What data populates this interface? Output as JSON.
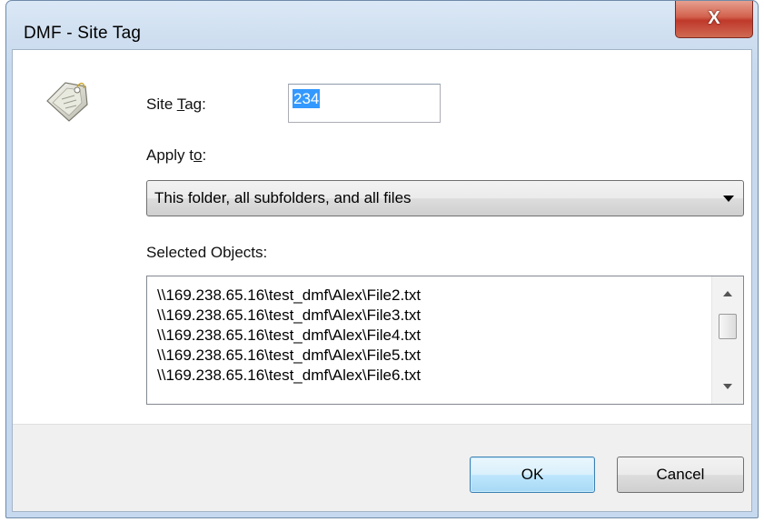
{
  "window": {
    "title": "DMF - Site Tag",
    "close_label": "X"
  },
  "form": {
    "site_tag_label_pre": "Site ",
    "site_tag_label_key": "T",
    "site_tag_label_post": "ag:",
    "site_tag_value": "234",
    "apply_to_label_pre": "Apply t",
    "apply_to_label_key": "o",
    "apply_to_label_post": ":",
    "apply_to_selected": "This folder, all subfolders, and all files",
    "selected_objects_label": "Selected Objects:",
    "selected_objects": [
      "\\\\169.238.65.16\\test_dmf\\Alex\\File2.txt",
      "\\\\169.238.65.16\\test_dmf\\Alex\\File3.txt",
      "\\\\169.238.65.16\\test_dmf\\Alex\\File4.txt",
      "\\\\169.238.65.16\\test_dmf\\Alex\\File5.txt",
      "\\\\169.238.65.16\\test_dmf\\Alex\\File6.txt"
    ]
  },
  "buttons": {
    "ok": "OK",
    "cancel": "Cancel"
  },
  "icons": {
    "app": "tag-icon",
    "close": "close-icon",
    "dropdown": "chevron-down-icon",
    "scroll_up": "scroll-up-icon",
    "scroll_down": "scroll-down-icon"
  },
  "colors": {
    "selection": "#3399ff",
    "close_button": "#c0392b",
    "default_button_border": "#3c7fb1"
  }
}
